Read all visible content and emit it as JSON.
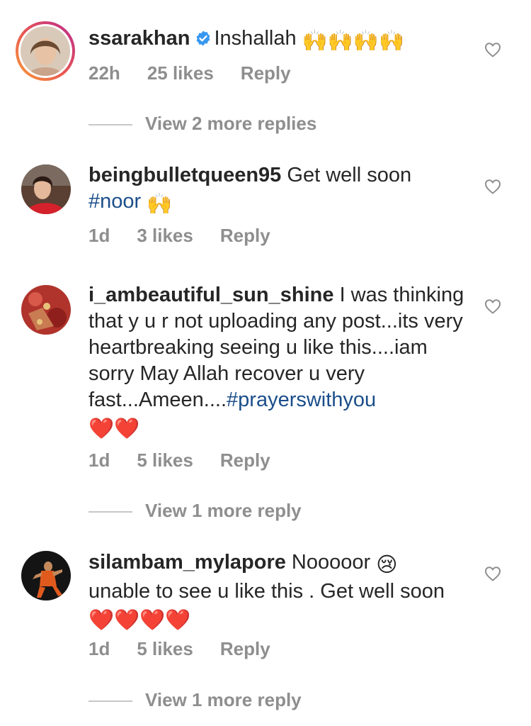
{
  "comments": [
    {
      "username": "ssarakhan",
      "verified": true,
      "text": "Inshallah",
      "emojis": "🙌🙌🙌🙌",
      "time": "22h",
      "likes": "25 likes",
      "reply": "Reply",
      "view_replies": "View 2 more replies"
    },
    {
      "username": "beingbulletqueen95",
      "text": "Get well soon",
      "hashtag": "#noor",
      "emojis": "🙌",
      "time": "1d",
      "likes": "3 likes",
      "reply": "Reply"
    },
    {
      "username": "i_ambeautiful_sun_shine",
      "text": "I was thinking that y u r not uploading any post...its very  heartbreaking seeing u like  this....iam sorry May Allah recover u very fast...Ameen....",
      "hashtag": "#prayerswithyou",
      "emojis": "❤️❤️",
      "time": "1d",
      "likes": "5 likes",
      "reply": "Reply",
      "view_replies": "View 1 more reply"
    },
    {
      "username": "silambam_mylapore",
      "text": "Nooooor",
      "emoji_after_text": "😢",
      "text2": "unable to see u like this . Get well soon",
      "emojis": "❤️❤️❤️❤️",
      "time": "1d",
      "likes": "5 likes",
      "reply": "Reply",
      "view_replies": "View 1 more reply"
    }
  ],
  "icons": {
    "like": "heart-outline-icon",
    "verified": "verified-badge-icon"
  },
  "colors": {
    "username": "#262626",
    "meta": "#8e8e8e",
    "hashtag": "#1b4e8a",
    "verified": "#3897f0"
  }
}
